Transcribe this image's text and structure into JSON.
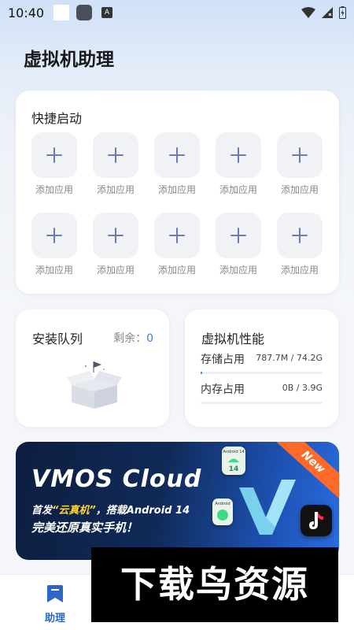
{
  "status_bar": {
    "time": "10:40",
    "notification_icon": "A"
  },
  "page": {
    "title": "虚拟机助理"
  },
  "quick_launch": {
    "title": "快捷启动",
    "slots": [
      {
        "label": "添加应用"
      },
      {
        "label": "添加应用"
      },
      {
        "label": "添加应用"
      },
      {
        "label": "添加应用"
      },
      {
        "label": "添加应用"
      },
      {
        "label": "添加应用"
      },
      {
        "label": "添加应用"
      },
      {
        "label": "添加应用"
      },
      {
        "label": "添加应用"
      },
      {
        "label": "添加应用"
      }
    ]
  },
  "install_queue": {
    "title": "安装队列",
    "remaining_label": "剩余：",
    "remaining_count": "0"
  },
  "vm_performance": {
    "title": "虚拟机性能",
    "storage": {
      "label": "存储占用",
      "value": "787.7M / 74.2G",
      "fraction": 0.0104
    },
    "memory": {
      "label": "内存占用",
      "value": "0B / 3.9G",
      "fraction": 0
    }
  },
  "banner": {
    "title": "VMOS Cloud",
    "subtitle_prefix": "首发",
    "subtitle_highlight": "“云真机”",
    "subtitle_suffix": "，搭载Android 14",
    "subtitle2": "完美还原真实手机！",
    "ribbon": "New",
    "android_badge_1": "Android 14",
    "android_badge_2": "Android",
    "android_version": "14"
  },
  "bottom_nav": {
    "items": [
      {
        "label": "助理",
        "icon": "bookmark-icon",
        "active": true
      }
    ]
  },
  "watermark": {
    "text": "下载鸟资源"
  },
  "colors": {
    "accent": "#3b7fe0",
    "nav_active": "#2e66c8"
  }
}
